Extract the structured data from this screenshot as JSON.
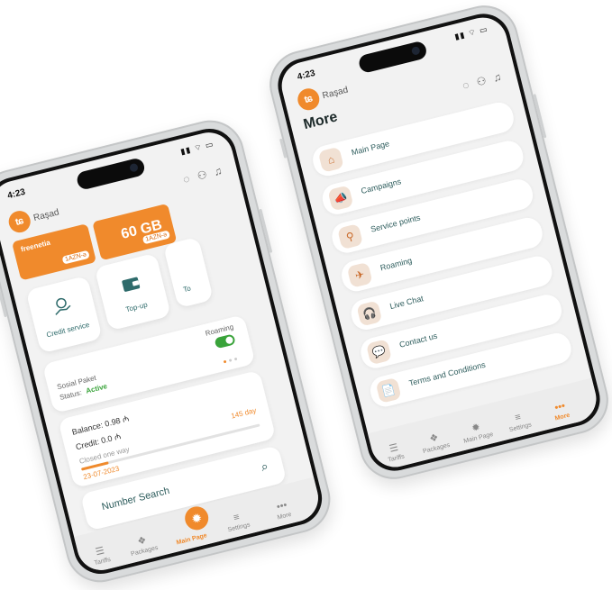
{
  "left_phone": {
    "time": "4:23",
    "username": "Raşad",
    "banners": [
      {
        "brand": "freenetia",
        "pill": "1AZN-ə"
      },
      {
        "big": "60 GB",
        "pill": "1AZN-ə"
      }
    ],
    "tiles": [
      {
        "label": "Credit service"
      },
      {
        "label": "Top-up"
      },
      {
        "label": "To"
      }
    ],
    "package": {
      "name": "Sosial Paket",
      "status_label": "Status:",
      "status_value": "Active",
      "roaming_label": "Roaming",
      "roaming_on": true
    },
    "balance": {
      "balance_text": "Balance: 0.98 ₼",
      "credit_text": "Credit: 0.0 ₼",
      "closed_label": "Closed one way",
      "days": "145 day",
      "date": "23-07-2023",
      "progress": 0.15
    },
    "number_search": "Number Search",
    "tabs": [
      {
        "label": "Tariffs",
        "icon": "☰"
      },
      {
        "label": "Packages",
        "icon": "❖"
      },
      {
        "label": "Main Page",
        "icon": "✹",
        "active": true
      },
      {
        "label": "Settings",
        "icon": "≡"
      },
      {
        "label": "More",
        "icon": "•••"
      }
    ]
  },
  "right_phone": {
    "time": "4:23",
    "username": "Raşad",
    "title": "More",
    "menu": [
      {
        "label": "Main Page",
        "icon": "⌂"
      },
      {
        "label": "Campaigns",
        "icon": "📣"
      },
      {
        "label": "Service points",
        "icon": "⚲"
      },
      {
        "label": "Roaming",
        "icon": "✈"
      },
      {
        "label": "Live Chat",
        "icon": "🎧"
      },
      {
        "label": "Contact us",
        "icon": "💬"
      },
      {
        "label": "Terms and Conditions",
        "icon": "📄"
      }
    ],
    "tabs": [
      {
        "label": "Tariffs",
        "icon": "☰"
      },
      {
        "label": "Packages",
        "icon": "❖"
      },
      {
        "label": "Main Page",
        "icon": "✹"
      },
      {
        "label": "Settings",
        "icon": "≡"
      },
      {
        "label": "More",
        "icon": "•••",
        "active": true
      }
    ]
  },
  "colors": {
    "accent": "#f08a2c",
    "teal_text": "#2e6b6b",
    "active_green": "#39a33a"
  }
}
